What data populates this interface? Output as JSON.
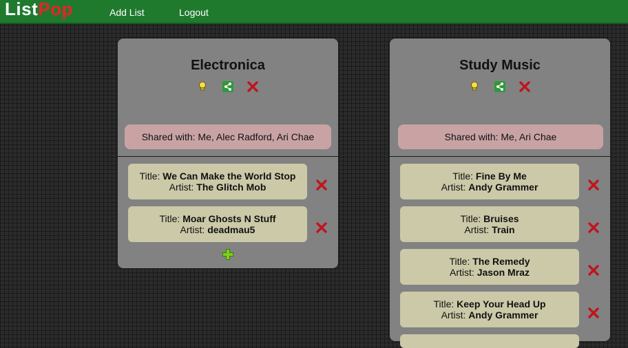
{
  "app": {
    "logo_part1": "List",
    "logo_part2": "Pop"
  },
  "nav": {
    "add_list": "Add List",
    "logout": "Logout"
  },
  "labels": {
    "title_prefix": "Title: ",
    "artist_prefix": "Artist: "
  },
  "colors": {
    "header": "#1f7a2e",
    "logo_accent": "#e8232a",
    "card": "#828282",
    "song_bg": "#cbc9a8",
    "shared_bg": "#c9a3a4",
    "delete": "#c0141d",
    "add": "#7bd11a"
  },
  "lists": [
    {
      "name": "Electronica",
      "shared_with": "Shared with: Me, Alec Radford, Ari Chae",
      "songs": [
        {
          "title": "We Can Make the World Stop",
          "artist": "The Glitch Mob"
        },
        {
          "title": "Moar Ghosts N Stuff",
          "artist": "deadmau5"
        }
      ]
    },
    {
      "name": "Study Music",
      "shared_with": "Shared with: Me, Ari Chae",
      "songs": [
        {
          "title": "Fine By Me",
          "artist": "Andy Grammer"
        },
        {
          "title": "Bruises",
          "artist": "Train"
        },
        {
          "title": "The Remedy",
          "artist": "Jason Mraz"
        },
        {
          "title": "Keep Your Head Up",
          "artist": "Andy Grammer"
        }
      ]
    }
  ]
}
